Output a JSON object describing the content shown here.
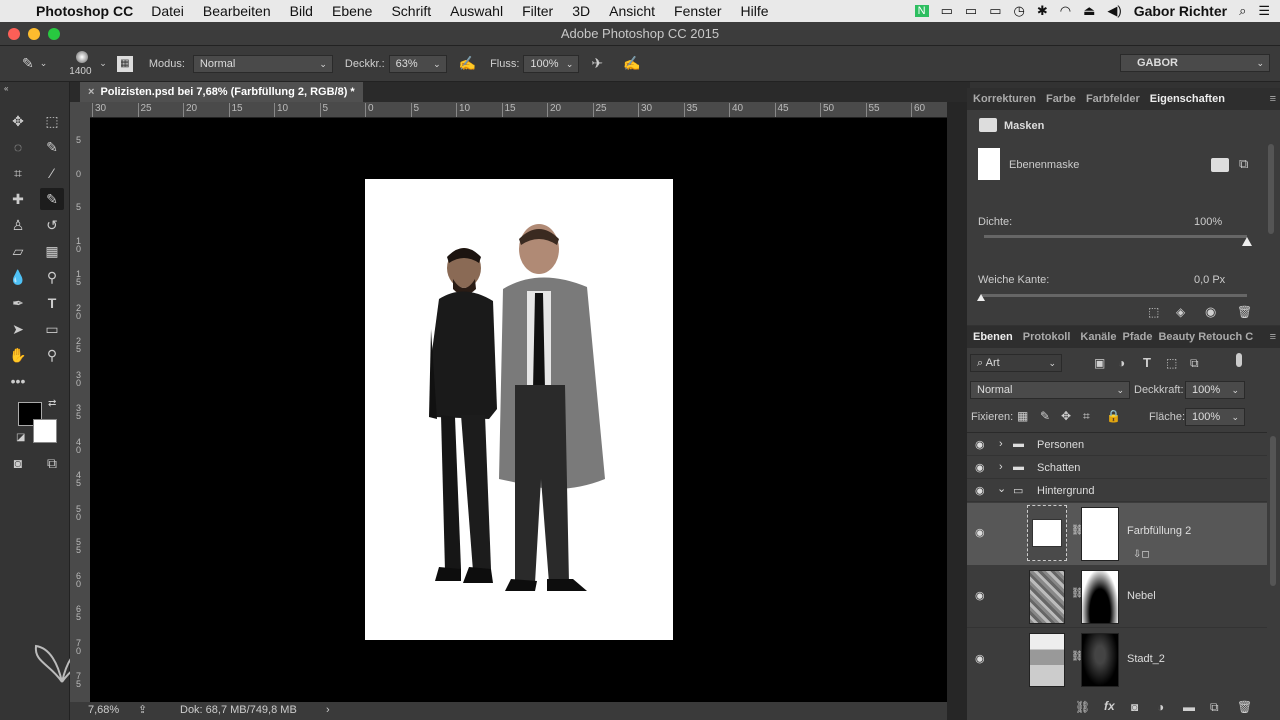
{
  "menubar": {
    "app": "Photoshop CC",
    "menus": [
      "Datei",
      "Bearbeiten",
      "Bild",
      "Ebene",
      "Schrift",
      "Auswahl",
      "Filter",
      "3D",
      "Ansicht",
      "Fenster",
      "Hilfe"
    ],
    "user": "Gabor Richter"
  },
  "window": {
    "title": "Adobe Photoshop CC 2015"
  },
  "options_bar": {
    "brush_size": "1400",
    "mode_label": "Modus:",
    "mode_value": "Normal",
    "opacity_label": "Deckkr.:",
    "opacity_value": "63%",
    "flow_label": "Fluss:",
    "flow_value": "100%",
    "workspace": "GABOR"
  },
  "document": {
    "tab": "Polizisten.psd bei 7,68% (Farbfüllung 2, RGB/8) *",
    "ruler_h": [
      "30",
      "25",
      "20",
      "15",
      "10",
      "5",
      "0",
      "5",
      "10",
      "15",
      "20",
      "25",
      "30",
      "35",
      "40",
      "45",
      "50",
      "55",
      "60"
    ],
    "ruler_v": [
      "5",
      "0",
      "5",
      "1 0",
      "1 5",
      "2 0",
      "2 5",
      "3 0",
      "3 5",
      "4 0",
      "4 5",
      "5 0",
      "5 5",
      "6 0",
      "6 5",
      "7 0",
      "7 5"
    ]
  },
  "status": {
    "zoom": "7,68%",
    "doc": "Dok: 68,7 MB/749,8 MB"
  },
  "properties_panel": {
    "tabs": [
      "Korrekturen",
      "Farbe",
      "Farbfelder",
      "Eigenschaften"
    ],
    "section": "Masken",
    "mask_type": "Ebenenmaske",
    "density_label": "Dichte:",
    "density_value": "100%",
    "density_level": 1.0,
    "feather_label": "Weiche Kante:",
    "feather_value": "0,0 Px",
    "feather_level": 0.0
  },
  "layers_panel": {
    "tabs": [
      "Ebenen",
      "Protokoll",
      "Kanäle",
      "Pfade",
      "Beauty Retouch C"
    ],
    "filter_kind": "Art",
    "blend_mode": "Normal",
    "opacity_label": "Deckkraft:",
    "opacity_value": "100%",
    "lock_label": "Fixieren:",
    "fill_label": "Fläche:",
    "fill_value": "100%",
    "layers": [
      {
        "name": "Personen",
        "type": "group"
      },
      {
        "name": "Schatten",
        "type": "group"
      },
      {
        "name": "Hintergrund",
        "type": "group-open"
      },
      {
        "name": "Farbfüllung 2",
        "type": "fill",
        "selected": true
      },
      {
        "name": "Nebel",
        "type": "pixel"
      },
      {
        "name": "Stadt_2",
        "type": "pixel"
      }
    ]
  },
  "colors": {
    "accent": "#4a90d9",
    "panel": "#3c3c3c",
    "canvas": "#000000"
  }
}
